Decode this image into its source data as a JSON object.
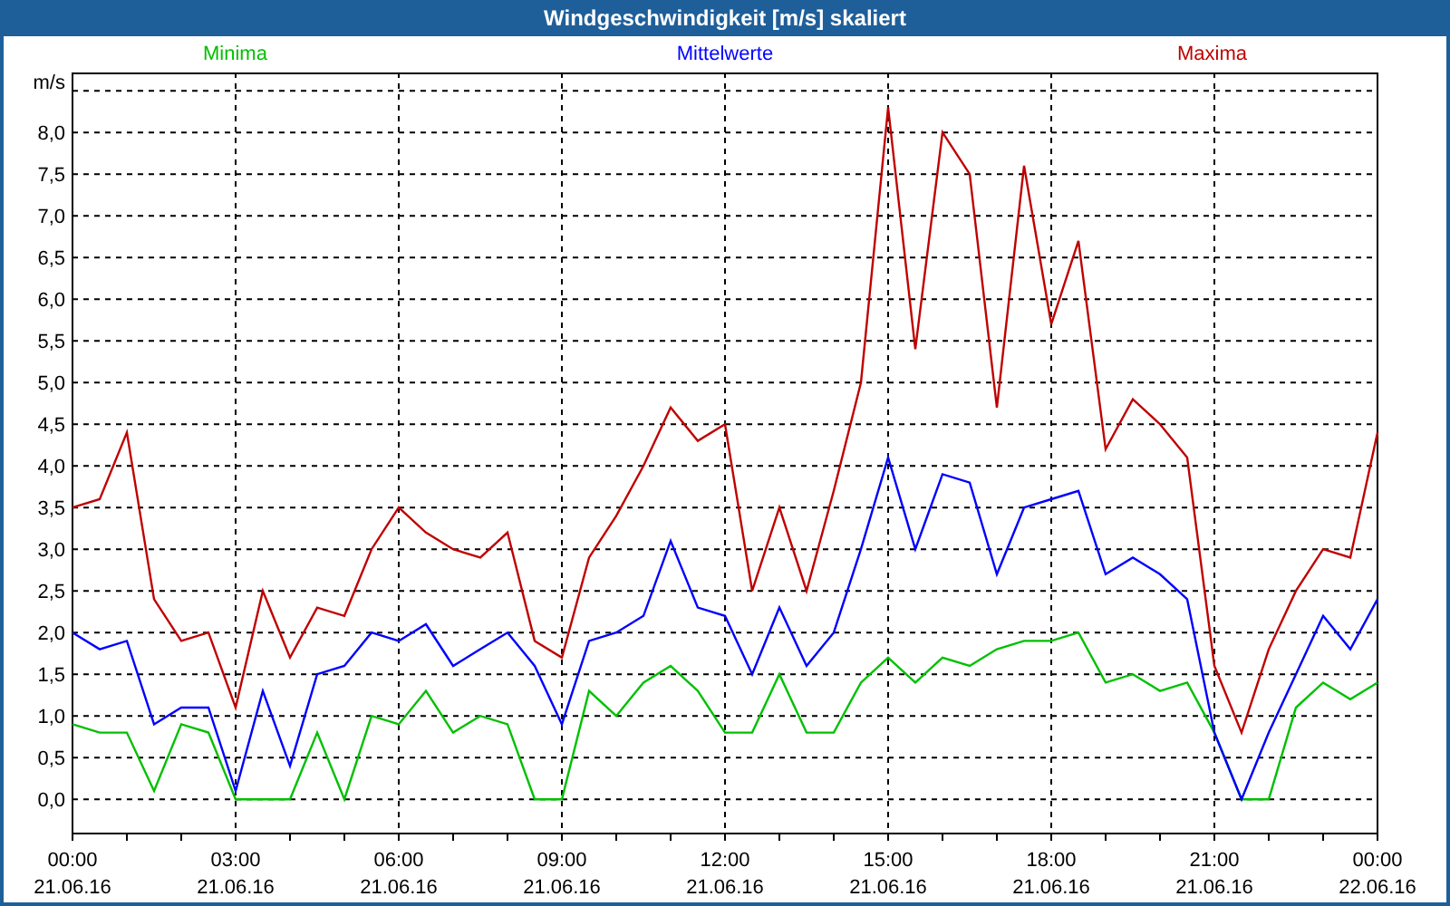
{
  "window": {
    "title": "Windgeschwindigkeit [m/s] skaliert"
  },
  "chart": {
    "chart_data": {
      "type": "line",
      "ylabel": "m/s",
      "categories": [
        "00:00 21.06.16",
        null,
        null,
        null,
        null,
        null,
        "03:00 21.06.16",
        null,
        null,
        null,
        null,
        null,
        "06:00 21.06.16",
        null,
        null,
        null,
        null,
        null,
        "09:00 21.06.16",
        null,
        null,
        null,
        null,
        null,
        "12:00 21.06.16",
        null,
        null,
        null,
        null,
        null,
        "15:00 21.06.16",
        null,
        null,
        null,
        null,
        null,
        "18:00 21.06.16",
        null,
        null,
        null,
        null,
        null,
        "21:00 21.06.16",
        null,
        null,
        null,
        null,
        null,
        "00:00 22.06.16"
      ],
      "series": [
        {
          "name": "Minima",
          "color": "#00c000",
          "values": [
            0.9,
            0.8,
            0.8,
            0.1,
            0.9,
            0.8,
            0.0,
            0.0,
            0.0,
            0.8,
            0.0,
            1.0,
            0.9,
            1.3,
            0.8,
            1.0,
            0.9,
            0.0,
            0.0,
            1.3,
            1.0,
            1.4,
            1.6,
            1.3,
            0.8,
            0.8,
            1.5,
            0.8,
            0.8,
            1.4,
            1.7,
            1.4,
            1.7,
            1.6,
            1.8,
            1.9,
            1.9,
            2.0,
            1.4,
            1.5,
            1.3,
            1.4,
            0.8,
            0.0,
            0.0,
            1.1,
            1.4,
            1.2,
            1.4
          ]
        },
        {
          "name": "Mittelwerte",
          "color": "#0000ff",
          "values": [
            2.0,
            1.8,
            1.9,
            0.9,
            1.1,
            1.1,
            0.1,
            1.3,
            0.4,
            1.5,
            1.6,
            2.0,
            1.9,
            2.1,
            1.6,
            1.8,
            2.0,
            1.6,
            0.9,
            1.9,
            2.0,
            2.2,
            3.1,
            2.3,
            2.2,
            1.5,
            2.3,
            1.6,
            2.0,
            3.0,
            4.1,
            3.0,
            3.9,
            3.8,
            2.7,
            3.5,
            3.6,
            3.7,
            2.7,
            2.9,
            2.7,
            2.4,
            0.8,
            0.0,
            0.8,
            1.5,
            2.2,
            1.8,
            2.4
          ]
        },
        {
          "name": "Maxima",
          "color": "#c00000",
          "values": [
            3.5,
            3.6,
            4.4,
            2.4,
            1.9,
            2.0,
            1.1,
            2.5,
            1.7,
            2.3,
            2.2,
            3.0,
            3.5,
            3.2,
            3.0,
            2.9,
            3.2,
            1.9,
            1.7,
            2.9,
            3.4,
            4.0,
            4.7,
            4.3,
            4.5,
            2.5,
            3.5,
            2.5,
            3.7,
            5.0,
            8.3,
            5.4,
            8.0,
            7.5,
            4.7,
            7.6,
            5.7,
            6.7,
            4.2,
            4.8,
            4.5,
            4.1,
            1.6,
            0.8,
            1.8,
            2.5,
            3.0,
            2.9,
            4.4
          ]
        }
      ],
      "ylim": [
        -0.41,
        8.72
      ],
      "yticks": [
        {
          "value": 0,
          "label": "0,0"
        },
        {
          "value": 0.5,
          "label": "0,5"
        },
        {
          "value": 1,
          "label": "1,0"
        },
        {
          "value": 1.5,
          "label": "1,5"
        },
        {
          "value": 2,
          "label": "2,0"
        },
        {
          "value": 2.5,
          "label": "2,5"
        },
        {
          "value": 3,
          "label": "3,0"
        },
        {
          "value": 3.5,
          "label": "3,5"
        },
        {
          "value": 4,
          "label": "4,0"
        },
        {
          "value": 4.5,
          "label": "4,5"
        },
        {
          "value": 5,
          "label": "5,0"
        },
        {
          "value": 5.5,
          "label": "5,5"
        },
        {
          "value": 6,
          "label": "6,0"
        },
        {
          "value": 6.5,
          "label": "6,5"
        },
        {
          "value": 7,
          "label": "7,0"
        },
        {
          "value": 7.5,
          "label": "7,5"
        },
        {
          "value": 8,
          "label": "8,0"
        }
      ],
      "grid": true
    }
  }
}
